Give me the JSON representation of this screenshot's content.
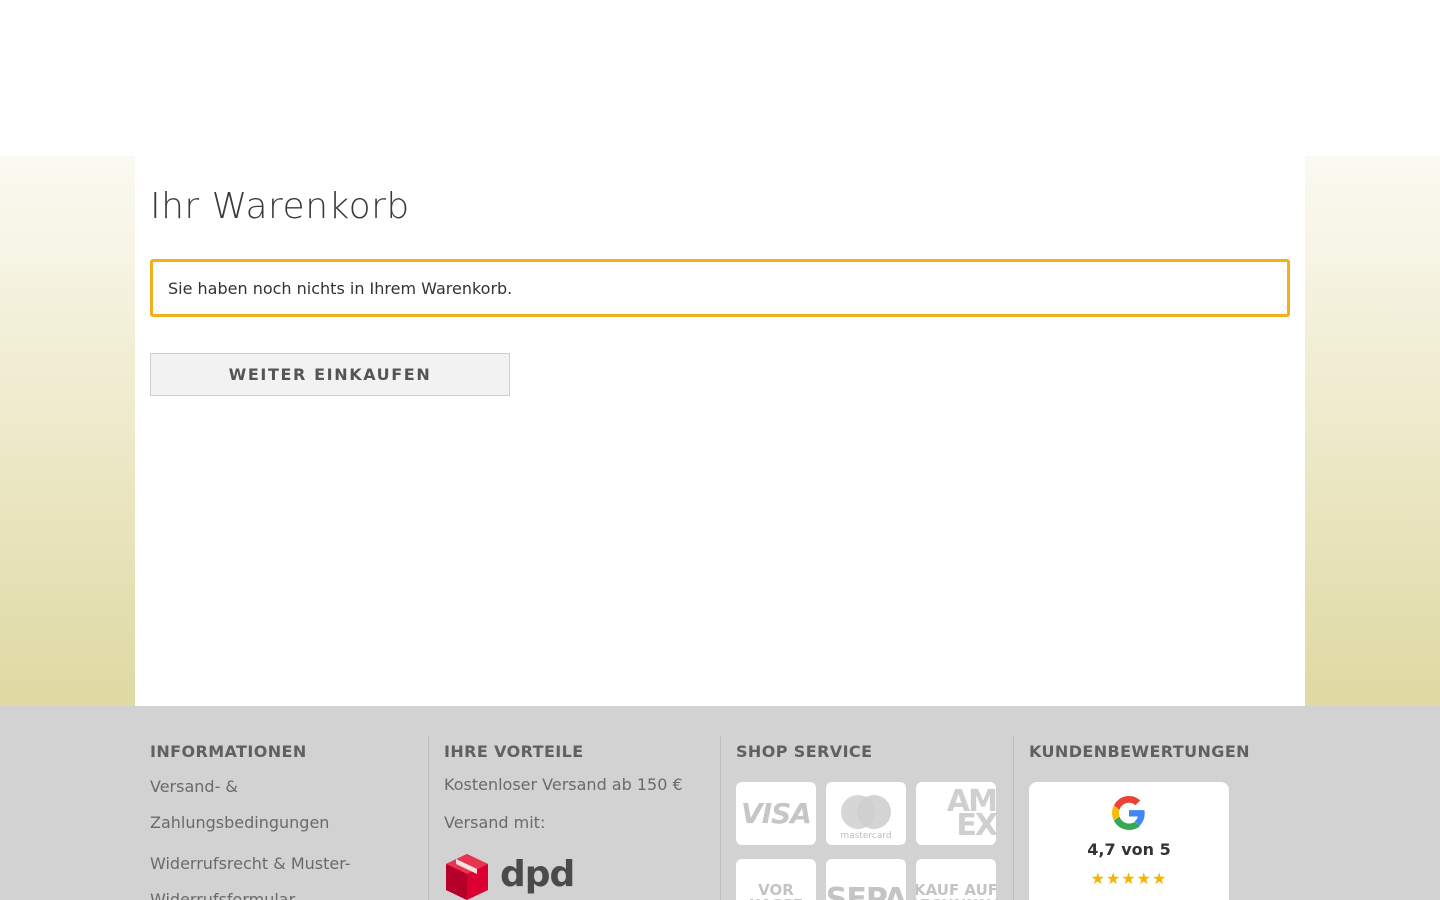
{
  "cart": {
    "title": "Ihr Warenkorb",
    "empty_message": "Sie haben noch nichts in Ihrem Warenkorb.",
    "continue_label": "WEITER EINKAUFEN"
  },
  "footer": {
    "informationen": {
      "heading": "INFORMATIONEN",
      "links": [
        "Versand- & Zahlungsbedingungen",
        "Widerrufsrecht & Muster-Widerrufsformular"
      ]
    },
    "vorteile": {
      "heading": "IHRE VORTEILE",
      "items": [
        "Kostenloser Versand ab 150 €",
        "Versand mit:"
      ],
      "carrier": "dpd"
    },
    "service": {
      "heading": "SHOP SERVICE",
      "payment_methods": [
        {
          "name": "VISA",
          "icon": "visa-icon"
        },
        {
          "name": "mastercard",
          "icon": "mastercard-icon"
        },
        {
          "name": "AM EX",
          "icon": "amex-icon"
        },
        {
          "name": "VOR KASSE",
          "icon": "vorkasse-icon"
        },
        {
          "name": "SEPA",
          "icon": "sepa-icon"
        },
        {
          "name": "KAUF AUF RECHNUNG",
          "icon": "rechnung-icon"
        }
      ]
    },
    "bewertungen": {
      "heading": "KUNDENBEWERTUNGEN",
      "rating_text": "4,7 von 5",
      "rating": 4.7,
      "stars": "★★★★★",
      "provider_icon": "google-icon"
    }
  },
  "colors": {
    "notice_border": "#efb01a",
    "footer_bg": "#d2d2d2",
    "star": "#f4b400",
    "dpd_red": "#dc0032"
  }
}
